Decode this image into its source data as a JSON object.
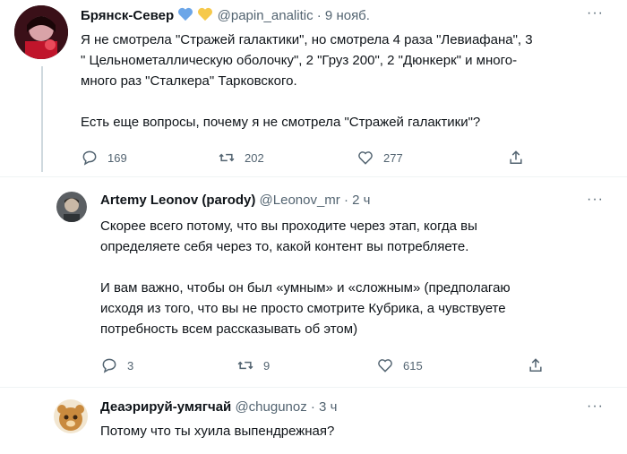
{
  "tweets": [
    {
      "name": "Брянск-Север",
      "badges": [
        "blue-heart",
        "yellow-heart"
      ],
      "badge_colors": [
        "#6ca6e8",
        "#f6c94b"
      ],
      "handle": "@papin_analitic",
      "time": "· 9 нояб.",
      "lines": [
        "Я не смотрела \"Стражей галактики\", но смотрела 4 раза \"Левиафана\", 3",
        "\" Цельнометаллическую оболочку\", 2 \"Груз 200\", 2 \"Дюнкерк\" и много-",
        "много раз \"Сталкера\" Тарковского.",
        "",
        "Есть еще вопросы, почему я не смотрела \"Стражей галактики\"?"
      ],
      "replies": "169",
      "retweets": "202",
      "likes": "277"
    },
    {
      "name": "Artemy Leonov (parody)",
      "handle": "@Leonov_mr",
      "time": "· 2 ч",
      "lines": [
        "Скорее всего потому, что вы проходите через этап, когда вы",
        "определяете себя через то, какой контент вы потребляете.",
        "",
        "И вам важно, чтобы он был «умным» и «сложным» (предполагаю",
        "исходя из того, что вы не просто смотрите Кубрика, а чувствуете",
        "потребность всем рассказывать об этом)"
      ],
      "replies": "3",
      "retweets": "9",
      "likes": "615"
    },
    {
      "name": "Деаэрируй-умягчай",
      "handle": "@chugunoz",
      "time": "· 3 ч",
      "lines": [
        "Потому что ты хуила выпендрежная?"
      ]
    }
  ]
}
